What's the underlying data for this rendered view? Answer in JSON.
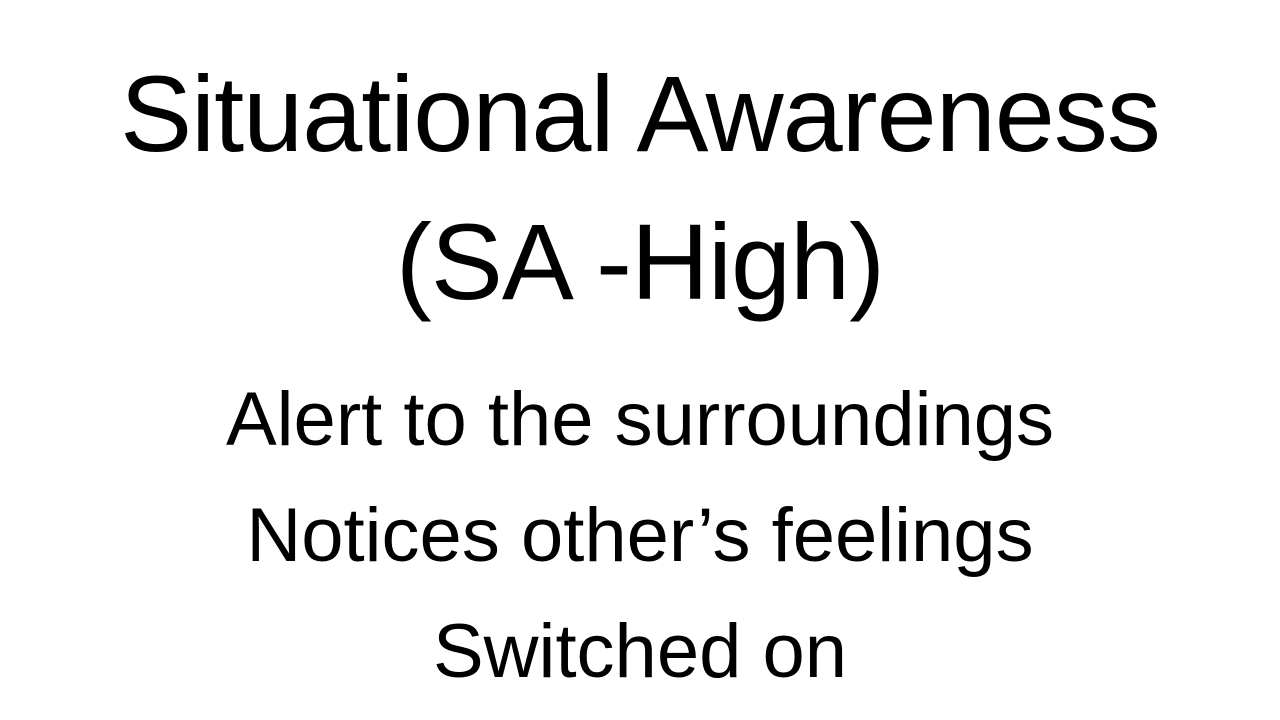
{
  "slide": {
    "title_line_1": "Situational Awareness",
    "title_line_2": "(SA -High)",
    "body_lines": [
      "Alert to the surroundings",
      "Notices other’s feelings",
      "Switched on"
    ],
    "colors": {
      "background": "#ffffff",
      "text": "#000000"
    }
  }
}
